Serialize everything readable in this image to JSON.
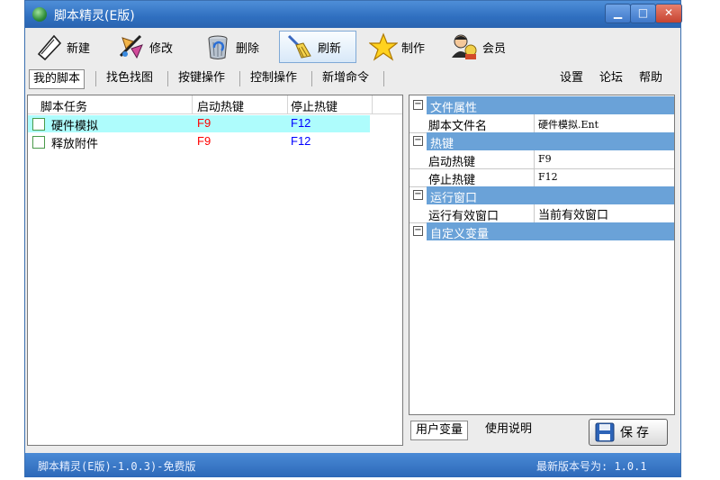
{
  "window": {
    "title": "脚本精灵(E版)"
  },
  "toolbar": [
    {
      "label": "新建",
      "icon": "new-document-icon"
    },
    {
      "label": "修改",
      "icon": "edit-brush-icon"
    },
    {
      "label": "删除",
      "icon": "trash-can-icon"
    },
    {
      "label": "刷新",
      "icon": "broom-icon"
    },
    {
      "label": "制作",
      "icon": "star-icon"
    },
    {
      "label": "会员",
      "icon": "member-people-icon"
    }
  ],
  "tabs": [
    "我的脚本",
    "找色找图",
    "按键操作",
    "控制操作",
    "新增命令"
  ],
  "right_links": [
    "设置",
    "论坛",
    "帮助"
  ],
  "list": {
    "headers": [
      "脚本任务",
      "启动热键",
      "停止热键"
    ],
    "rows": [
      {
        "name": "硬件模拟",
        "start": "F9",
        "stop": "F12",
        "selected": true
      },
      {
        "name": "释放附件",
        "start": "F9",
        "stop": "F12",
        "selected": false
      }
    ]
  },
  "properties": {
    "cat_file": "文件属性",
    "file_key": "脚本文件名",
    "file_val": "硬件模拟.Ent",
    "cat_hotkey": "热键",
    "start_key": "启动热键",
    "start_val": "F9",
    "stop_key": "停止热键",
    "stop_val": "F12",
    "cat_window": "运行窗口",
    "window_key": "运行有效窗口",
    "window_val": "当前有效窗口",
    "cat_vars": "自定义变量"
  },
  "bottom_tabs": [
    "用户变量",
    "使用说明"
  ],
  "save_label": "保存",
  "status": {
    "left": "脚本精灵(E版)-1.0.3)-免费版",
    "right": "最新版本号为: 1.0.1"
  },
  "colors": {
    "accent": "#3a78c8",
    "category": "#6aa2d8",
    "selected_row": "#aefcfc",
    "start_key": "#ff0000",
    "stop_key": "#0000ff"
  }
}
